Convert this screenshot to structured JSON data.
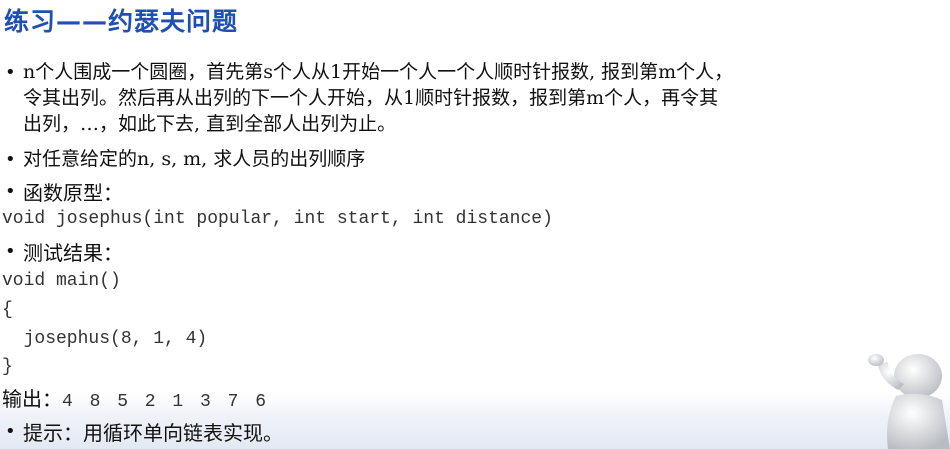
{
  "title": "练习——约瑟夫问题",
  "desc": [
    "n个人围成一个圆圈，首先第s个人从1开始一个人一个人顺时针报数, 报到第m个人，",
    "令其出列。然后再从出列的下一个人开始，从1顺时针报数，报到第m个人，再令其",
    "出列，…，如此下去, 直到全部人出列为止。"
  ],
  "task": "对任意给定的n, s, m, 求人员的出列顺序",
  "prototype_head": "函数原型：",
  "prototype_code": "void josephus(int popular, int start, int distance)",
  "test_head": "测试结果：",
  "test_code": [
    "void main()",
    "{",
    "  josephus(8, 1, 4)",
    "}"
  ],
  "output_label": "输出：",
  "output_values": "4 8 5 2 1 3 7 6",
  "hint": "提示：用循环单向链表实现。",
  "bullet_char": "•",
  "colors": {
    "title": "#1f4fb3",
    "code": "#333333"
  }
}
